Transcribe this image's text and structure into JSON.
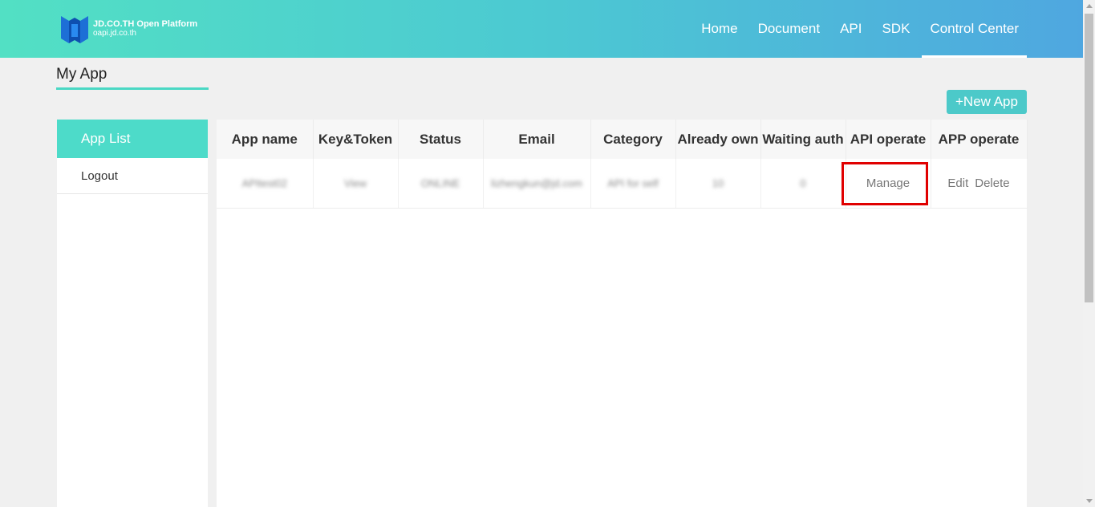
{
  "header": {
    "logo_title": "JD.CO.TH Open Platform",
    "logo_subtitle": "oapi.jd.co.th",
    "nav": [
      "Home",
      "Document",
      "API",
      "SDK",
      "Control Center"
    ],
    "active_nav": "Control Center"
  },
  "page": {
    "title": "My App",
    "new_app_label": "+New App"
  },
  "sidebar": {
    "items": [
      "App List",
      "Logout"
    ],
    "active": "App List"
  },
  "table": {
    "columns": [
      "App name",
      "Key&Token",
      "Status",
      "Email",
      "Category",
      "Already own",
      "Waiting auth",
      "API operate",
      "APP operate"
    ],
    "rows": [
      {
        "app_name": "APItest02",
        "key_token": "View",
        "status": "ONLINE",
        "email": "lizhengkun@jd.com",
        "category": "API for self",
        "already_own": "10",
        "waiting_auth": "0",
        "api_operate": "Manage",
        "app_edit": "Edit",
        "app_delete": "Delete"
      }
    ]
  },
  "colors": {
    "accent": "#4ddbc9",
    "highlight": "#e00000"
  }
}
